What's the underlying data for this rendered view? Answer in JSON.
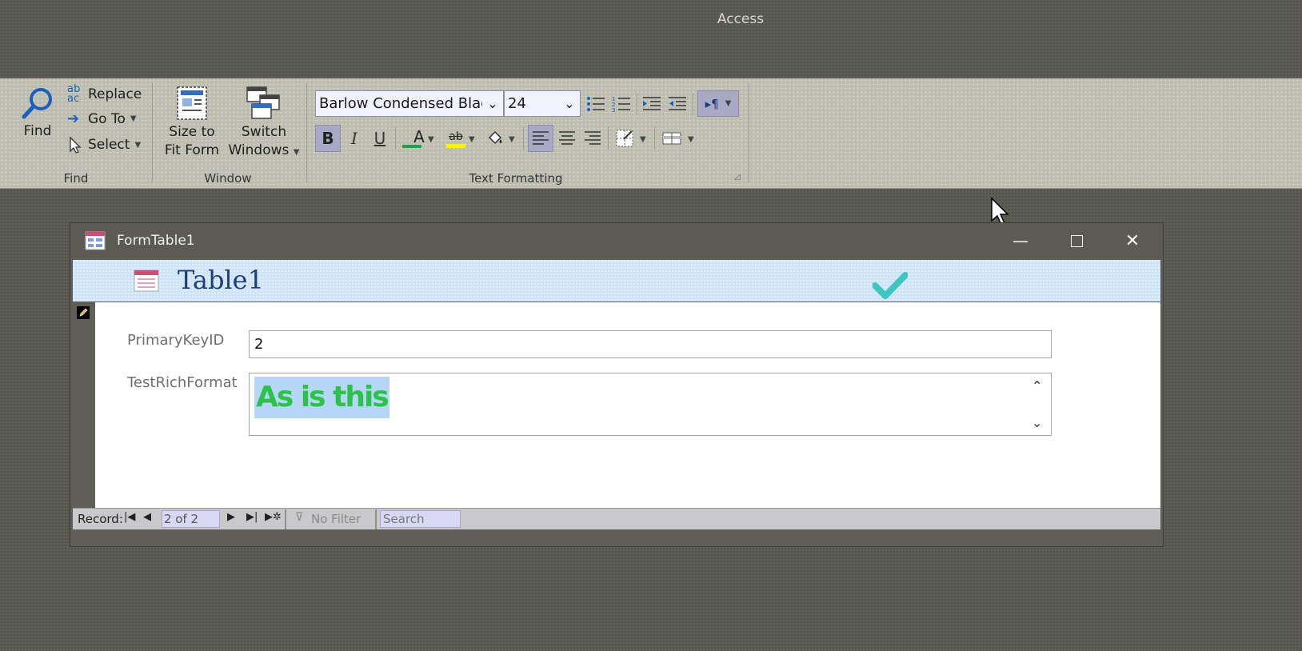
{
  "app": {
    "title": "Access"
  },
  "ribbon": {
    "find_group": {
      "find_label": "Find",
      "replace_label": "Replace",
      "goto_label": "Go To",
      "select_label": "Select",
      "group_label": "Find"
    },
    "window_group": {
      "size_to_fit_line1": "Size to",
      "size_to_fit_line2": "Fit Form",
      "switch_windows_line1": "Switch",
      "switch_windows_line2": "Windows",
      "group_label": "Window"
    },
    "text_formatting": {
      "font_name": "Barlow Condensed Black",
      "font_size": "24",
      "bold_label": "B",
      "italic_label": "I",
      "underline_label": "U",
      "font_color_label": "A",
      "highlight_label": "ab",
      "group_label": "Text Formatting",
      "font_color": "#1fa34a",
      "highlight_color": "#fff200"
    }
  },
  "form_window": {
    "title": "FormTable1",
    "heading": "Table1",
    "fields": {
      "primary_key_label": "PrimaryKeyID",
      "primary_key_value": "2",
      "rich_label": "TestRichFormat",
      "rich_value": "As is this"
    },
    "navigation": {
      "record_label": "Record:",
      "record_counter": "2 of 2",
      "no_filter_label": "No Filter",
      "search_placeholder": "Search"
    }
  },
  "colors": {
    "header_bg": "#cde4fb",
    "heading_text": "#1f3f72",
    "rich_text": "#2cc24a",
    "rich_highlight": "#b6d6f7",
    "checkmark": "#3ec6c0"
  }
}
